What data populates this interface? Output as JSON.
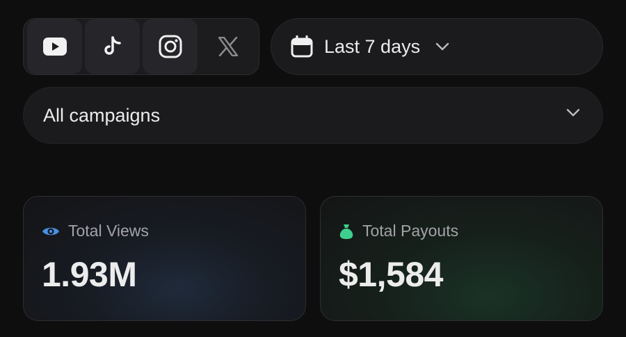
{
  "platforms": [
    {
      "name": "youtube-icon",
      "active": true
    },
    {
      "name": "tiktok-icon",
      "active": true
    },
    {
      "name": "instagram-icon",
      "active": true
    },
    {
      "name": "x-icon",
      "active": false
    }
  ],
  "date_filter": {
    "label": "Last 7 days"
  },
  "campaign_filter": {
    "label": "All campaigns"
  },
  "stats": {
    "views": {
      "title": "Total Views",
      "value": "1.93M",
      "icon": "eye-icon",
      "accent": "#4a90e2"
    },
    "payouts": {
      "title": "Total Payouts",
      "value": "$1,584",
      "icon": "money-bag-icon",
      "accent": "#3ecf8e"
    }
  }
}
